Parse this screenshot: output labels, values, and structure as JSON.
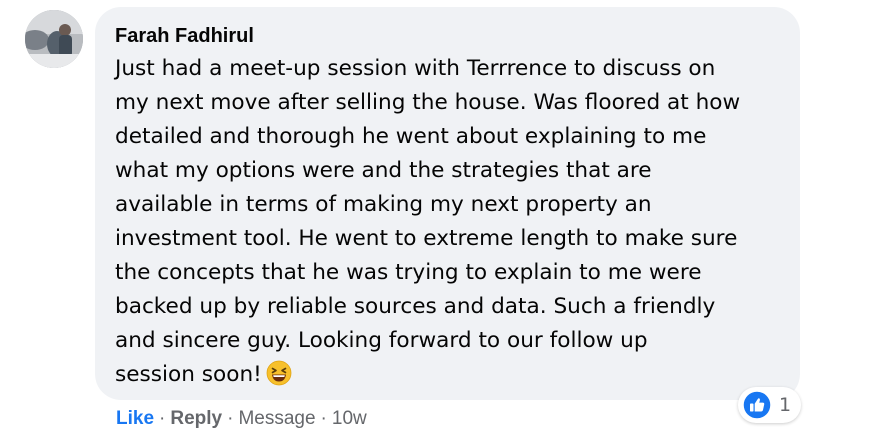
{
  "comment": {
    "author": "Farah Fadhirul",
    "lines": [
      "Just had a meet-up session with Terrrence to discuss on",
      "my next move after selling the house. Was floored at how",
      "detailed and thorough he went about explaining to me",
      "what my options were and the strategies that are",
      "available in terms of making my next property an",
      "investment tool. He went to extreme length to make sure",
      "the concepts that he was trying to explain to me were",
      "backed up by reliable sources and data. Such a friendly",
      "and sincere guy. Looking forward to our follow up",
      "session soon!"
    ],
    "emoji": "grinning-squinting-face-icon"
  },
  "reactions": {
    "icon": "like-thumb-icon",
    "count": "1",
    "color": "#1877f2"
  },
  "actions": {
    "like_label": "Like",
    "separator": "·",
    "reply_label": "Reply",
    "message_label": "Message",
    "time": "10w"
  },
  "colors": {
    "bubble": "#f0f2f5",
    "link_blue": "#1877f2",
    "secondary": "#65676b"
  }
}
